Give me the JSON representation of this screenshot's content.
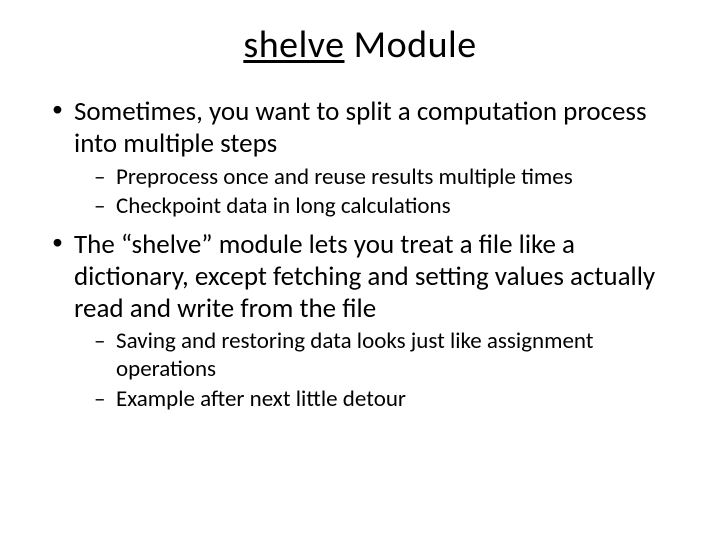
{
  "title": {
    "underlined": "shelve",
    "rest": " Module"
  },
  "bullets": [
    {
      "text": "Sometimes, you want to split a computation process into multiple steps",
      "sub": [
        "Preprocess once and reuse results multiple times",
        "Checkpoint data in long calculations"
      ]
    },
    {
      "text": "The “shelve” module lets you treat a file like a dictionary, except fetching and setting values actually read and write from the file",
      "sub": [
        "Saving and restoring data looks just like assignment operations",
        "Example after next little detour"
      ]
    }
  ]
}
